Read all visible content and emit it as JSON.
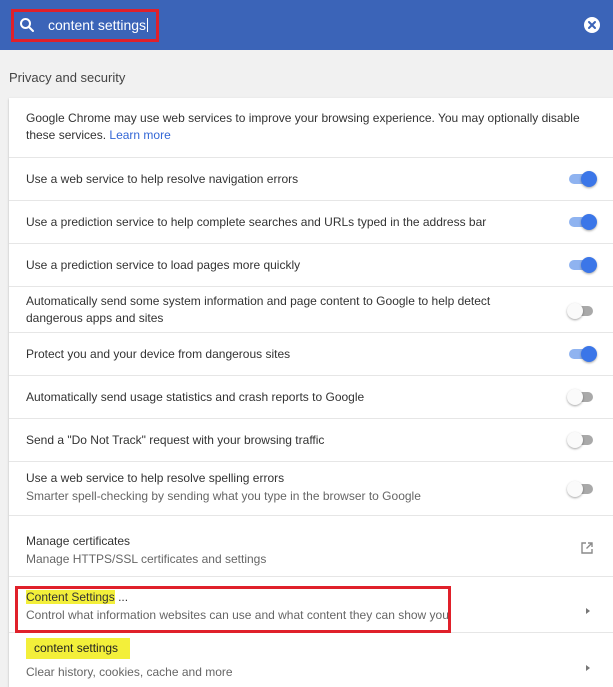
{
  "search": {
    "value": "content settings",
    "icon": "search-icon",
    "clear_icon": "clear-icon"
  },
  "section": {
    "title": "Privacy and security"
  },
  "intro": {
    "text": "Google Chrome may use web services to improve your browsing experience. You may optionally disable these services.",
    "link": "Learn more"
  },
  "toggles": [
    {
      "label": "Use a web service to help resolve navigation errors",
      "state": "on"
    },
    {
      "label": "Use a prediction service to help complete searches and URLs typed in the address bar",
      "state": "on"
    },
    {
      "label": "Use a prediction service to load pages more quickly",
      "state": "on"
    },
    {
      "label": "Automatically send some system information and page content to Google to help detect dangerous apps and sites",
      "state": "off"
    },
    {
      "label": "Protect you and your device from dangerous sites",
      "state": "on"
    },
    {
      "label": "Automatically send usage statistics and crash reports to Google",
      "state": "off"
    },
    {
      "label": "Send a \"Do Not Track\" request with your browsing traffic",
      "state": "off"
    },
    {
      "label": "Use a web service to help resolve spelling errors",
      "sublabel": "Smarter spell-checking by sending what you type in the browser to Google",
      "state": "off"
    }
  ],
  "certificates": {
    "title": "Manage certificates",
    "subtitle": "Manage HTTPS/SSL certificates and settings"
  },
  "content_settings": {
    "title": "Content Settings",
    "title_suffix": " ...",
    "subtitle": "Control what information websites can use and what content they can show you"
  },
  "clear_browsing": {
    "tooltip": "content settings",
    "subtitle": "Clear history, cookies, cache and more"
  },
  "colors": {
    "header": "#3b64b8",
    "toggle_on": "#3b76e8",
    "highlight": "#f3ef3a",
    "annotation_box": "#e0202a"
  }
}
